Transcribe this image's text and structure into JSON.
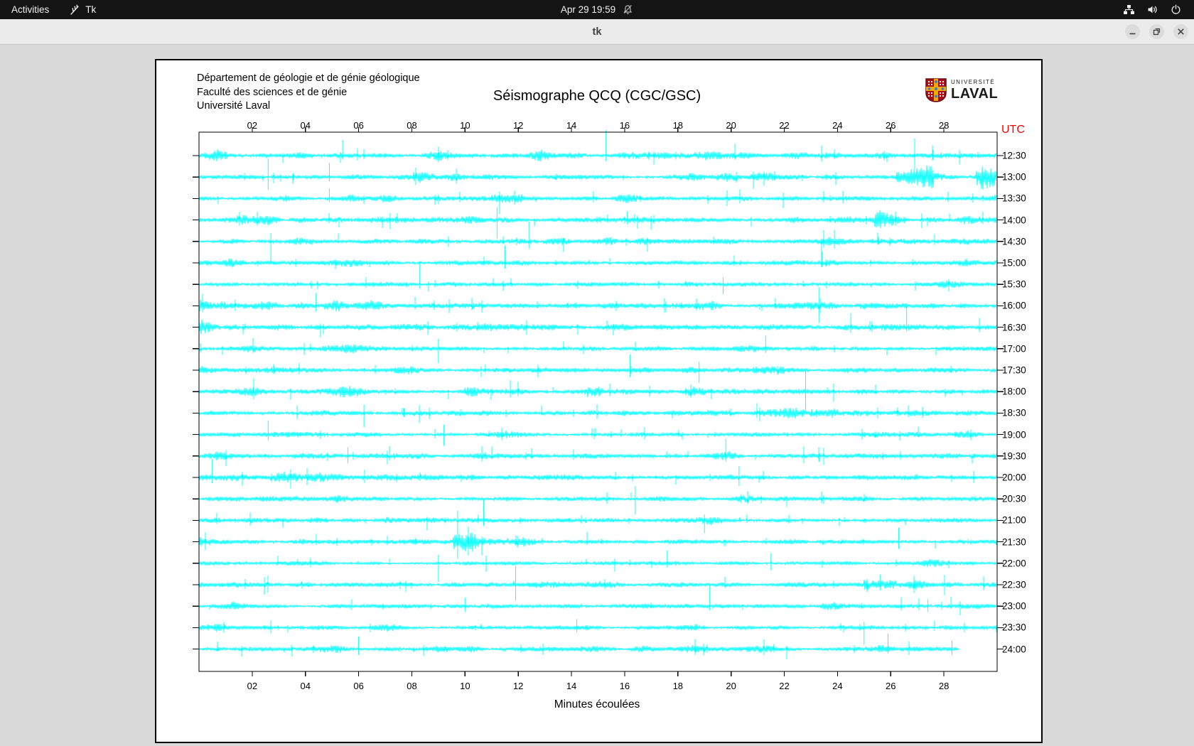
{
  "topbar": {
    "activities_label": "Activities",
    "app_name": "Tk",
    "clock": "Apr 29  19:59"
  },
  "titlebar": {
    "title": "tk"
  },
  "seismograph": {
    "header_lines": [
      "Département de géologie et de génie géologique",
      "Faculté des sciences et de génie",
      "Université Laval"
    ],
    "title": "Séismographe QCQ (CGC/GSC)",
    "logo": {
      "line1": "UNIVERSITÉ",
      "line2": "LAVAL"
    },
    "chart_data": {
      "type": "seismogram-helicorder",
      "title": "Séismographe QCQ (CGC/GSC)",
      "x_axis": {
        "label": "Minutes écoulées",
        "range": [
          0,
          30
        ],
        "tick_values": [
          2,
          4,
          6,
          8,
          10,
          12,
          14,
          16,
          18,
          20,
          22,
          24,
          26,
          28
        ],
        "tick_labels": [
          "02",
          "04",
          "06",
          "08",
          "10",
          "12",
          "14",
          "16",
          "18",
          "20",
          "22",
          "24",
          "26",
          "28"
        ]
      },
      "y_axis": {
        "label": "UTC"
      },
      "trace_color": "#00FFFF",
      "background": "#FFFFFF",
      "seed": 20240429,
      "traces": [
        {
          "label": "12:30",
          "amp": 3.0,
          "spikes": [
            {
              "t": 5.4,
              "up": 22,
              "dn": 6
            },
            {
              "t": 15.3,
              "up": 36,
              "dn": 8
            },
            {
              "t": 26.9,
              "up": 24,
              "dn": 20
            }
          ]
        },
        {
          "label": "13:00",
          "amp": 2.6,
          "events": [
            {
              "t0": 26.2,
              "t1": 27.6,
              "mult": 2.8
            },
            {
              "t0": 29.2,
              "t1": 30,
              "mult": 4.2
            }
          ],
          "spikes": [
            {
              "t": 2.6,
              "up": 26,
              "dn": 18
            },
            {
              "t": 4.9,
              "up": 20,
              "dn": 6
            }
          ]
        },
        {
          "label": "13:30",
          "amp": 2.4,
          "events": [
            {
              "t0": 11.0,
              "t1": 12.2,
              "mult": 1.8
            }
          ],
          "spikes": [
            {
              "t": 4.9,
              "up": 14,
              "dn": 5
            },
            {
              "t": 11.3,
              "up": 10,
              "dn": 22
            }
          ]
        },
        {
          "label": "14:00",
          "amp": 2.8,
          "events": [
            {
              "t0": 1.4,
              "t1": 3.0,
              "mult": 1.7
            },
            {
              "t0": 25.4,
              "t1": 26.6,
              "mult": 2.4
            }
          ],
          "spikes": [
            {
              "t": 11.2,
              "up": 18,
              "dn": 26
            },
            {
              "t": 16.1,
              "up": 12,
              "dn": 6
            }
          ]
        },
        {
          "label": "14:30",
          "amp": 2.5,
          "spikes": [
            {
              "t": 2.7,
              "up": 12,
              "dn": 30
            },
            {
              "t": 12.4,
              "up": 28,
              "dn": 10
            }
          ]
        },
        {
          "label": "15:00",
          "amp": 2.6,
          "spikes": [
            {
              "t": 11.5,
              "up": 24,
              "dn": 8
            },
            {
              "t": 23.4,
              "up": 30,
              "dn": 6
            }
          ]
        },
        {
          "label": "15:30",
          "amp": 2.2,
          "spikes": [
            {
              "t": 8.3,
              "up": 32,
              "dn": 6
            },
            {
              "t": 19.7,
              "up": 10,
              "dn": 14
            }
          ]
        },
        {
          "label": "16:00",
          "amp": 2.9,
          "events": [
            {
              "t0": 0,
              "t1": 1.0,
              "mult": 2.1
            }
          ],
          "spikes": [
            {
              "t": 4.4,
              "up": 18,
              "dn": 8
            },
            {
              "t": 23.3,
              "up": 26,
              "dn": 24
            }
          ]
        },
        {
          "label": "16:30",
          "amp": 2.9,
          "events": [
            {
              "t0": 0,
              "t1": 0.8,
              "mult": 2.5
            }
          ],
          "spikes": [
            {
              "t": 24.5,
              "up": 20,
              "dn": 8
            },
            {
              "t": 26.6,
              "up": 34,
              "dn": 6
            }
          ]
        },
        {
          "label": "17:00",
          "amp": 2.4,
          "spikes": [
            {
              "t": 9.0,
              "up": 14,
              "dn": 20
            },
            {
              "t": 21.3,
              "up": 18,
              "dn": 6
            }
          ]
        },
        {
          "label": "17:30",
          "amp": 2.4,
          "events": [
            {
              "t0": 20.8,
              "t1": 22.0,
              "mult": 1.8
            }
          ],
          "spikes": [
            {
              "t": 16.2,
              "up": 22,
              "dn": 10
            },
            {
              "t": 18.8,
              "up": 12,
              "dn": 18
            }
          ]
        },
        {
          "label": "18:00",
          "amp": 2.6,
          "events": [
            {
              "t0": 14.6,
              "t1": 15.2,
              "mult": 1.9
            }
          ],
          "spikes": [
            {
              "t": 11.7,
              "up": 16,
              "dn": 8
            },
            {
              "t": 22.8,
              "up": 30,
              "dn": 26
            }
          ]
        },
        {
          "label": "18:30",
          "amp": 2.7,
          "events": [
            {
              "t0": 23.0,
              "t1": 24.0,
              "mult": 2.0
            }
          ],
          "spikes": [
            {
              "t": 6.2,
              "up": 12,
              "dn": 20
            }
          ]
        },
        {
          "label": "19:00",
          "amp": 2.3,
          "spikes": [
            {
              "t": 2.6,
              "up": 20,
              "dn": 8
            },
            {
              "t": 9.2,
              "up": 14,
              "dn": 16
            }
          ]
        },
        {
          "label": "19:30",
          "amp": 2.5,
          "spikes": [
            {
              "t": 5.6,
              "up": 12,
              "dn": 10
            },
            {
              "t": 19.8,
              "up": 24,
              "dn": 8
            }
          ]
        },
        {
          "label": "20:00",
          "amp": 2.7,
          "spikes": [
            {
              "t": 0.5,
              "up": 26,
              "dn": 8
            },
            {
              "t": 20.3,
              "up": 16,
              "dn": 12
            }
          ]
        },
        {
          "label": "20:30",
          "amp": 2.3,
          "events": [
            {
              "t0": 5.0,
              "t1": 7.0,
              "mult": 1.6
            }
          ],
          "spikes": [
            {
              "t": 16.4,
              "up": 18,
              "dn": 22
            }
          ]
        },
        {
          "label": "21:00",
          "amp": 2.2,
          "spikes": [
            {
              "t": 10.7,
              "up": 30,
              "dn": 8
            },
            {
              "t": 19.0,
              "up": 8,
              "dn": 18
            }
          ]
        },
        {
          "label": "21:30",
          "amp": 2.3,
          "events": [
            {
              "t0": 9.55,
              "t1": 10.4,
              "mult": 3.2
            },
            {
              "t0": 10.4,
              "t1": 11.6,
              "mult": 1.9
            }
          ],
          "spikes": [
            {
              "t": 9.72,
              "up": 44,
              "dn": 24
            },
            {
              "t": 26.3,
              "up": 20,
              "dn": 10
            }
          ]
        },
        {
          "label": "22:00",
          "amp": 2.1,
          "spikes": [
            {
              "t": 9.0,
              "up": 12,
              "dn": 26
            },
            {
              "t": 17.6,
              "up": 18,
              "dn": 6
            },
            {
              "t": 21.5,
              "up": 14,
              "dn": 10
            }
          ]
        },
        {
          "label": "22:30",
          "amp": 2.5,
          "events": [
            {
              "t0": 25.0,
              "t1": 26.2,
              "mult": 2.1
            }
          ],
          "spikes": [
            {
              "t": 11.9,
              "up": 26,
              "dn": 22
            },
            {
              "t": 25.6,
              "up": 14,
              "dn": 8
            }
          ]
        },
        {
          "label": "23:00",
          "amp": 2.1,
          "spikes": [
            {
              "t": 10.0,
              "up": 12,
              "dn": 8
            },
            {
              "t": 19.2,
              "up": 30,
              "dn": 6
            },
            {
              "t": 27.4,
              "up": 10,
              "dn": 8
            }
          ]
        },
        {
          "label": "23:30",
          "amp": 1.9,
          "spikes": [
            {
              "t": 2.7,
              "up": 10,
              "dn": 8
            },
            {
              "t": 14.2,
              "up": 12,
              "dn": 6
            },
            {
              "t": 25.0,
              "up": 8,
              "dn": 24
            }
          ]
        },
        {
          "label": "24:00",
          "amp": 2.1,
          "end": 28.6,
          "spikes": [
            {
              "t": 6.0,
              "up": 18,
              "dn": 8
            },
            {
              "t": 25.9,
              "up": 22,
              "dn": 6
            },
            {
              "t": 28.3,
              "up": 12,
              "dn": 8
            }
          ]
        }
      ]
    }
  }
}
